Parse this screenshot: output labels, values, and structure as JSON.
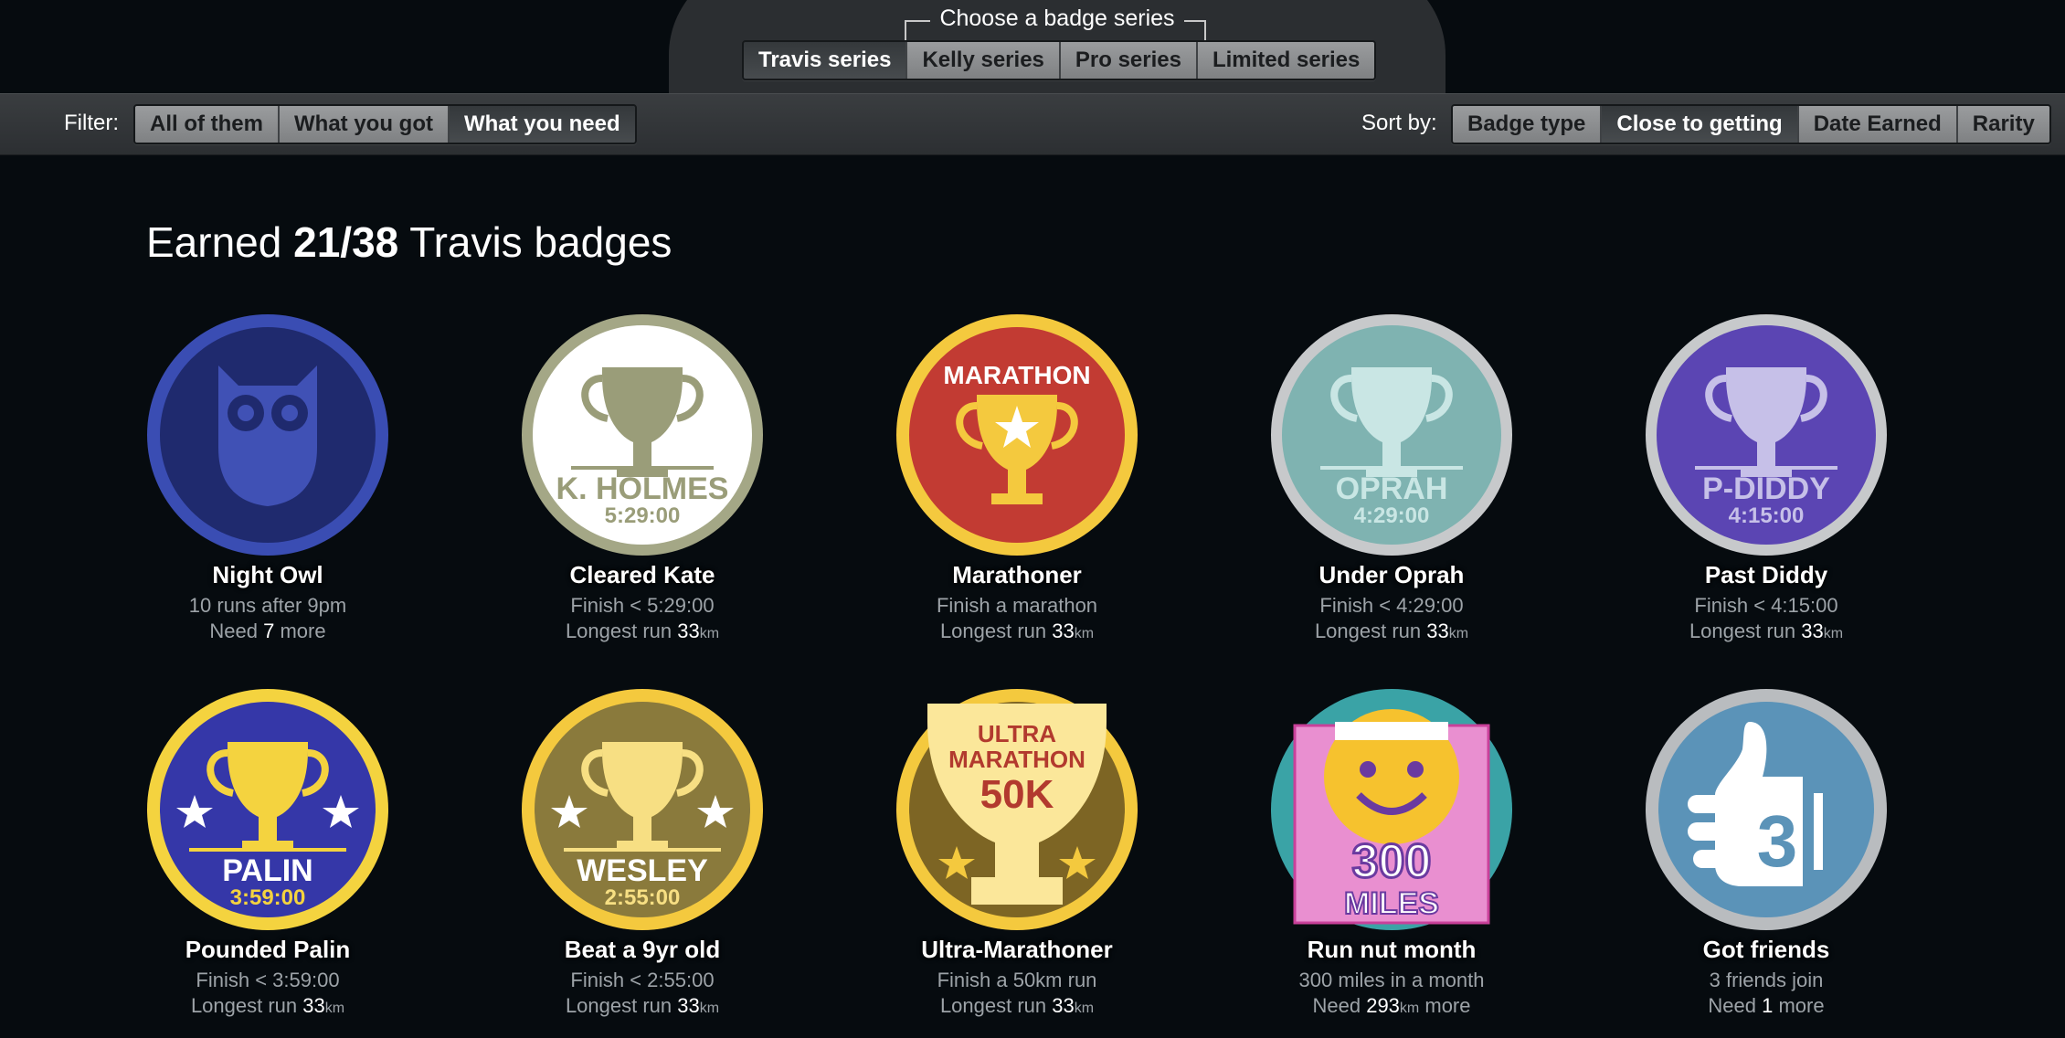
{
  "series": {
    "caption": "Choose a badge series",
    "tabs": [
      "Travis series",
      "Kelly series",
      "Pro series",
      "Limited series"
    ],
    "active": 0
  },
  "filter": {
    "label": "Filter:",
    "options": [
      "All of them",
      "What you got",
      "What you need"
    ],
    "active": 2
  },
  "sort": {
    "label": "Sort by:",
    "options": [
      "Badge type",
      "Close to getting",
      "Date Earned",
      "Rarity"
    ],
    "active": 1
  },
  "heading": {
    "prefix": "Earned ",
    "earned": "21/38",
    "suffix": " Travis badges"
  },
  "badges": [
    {
      "title": "Night Owl",
      "desc": "10 runs after 9pm",
      "need_pre": "Need ",
      "need_val": "7",
      "need_unit": "",
      "need_post": " more",
      "art": "owl",
      "art_text": "",
      "art_time": "",
      "colors": {
        "ring": "#3a4db3",
        "face": "#1f2a6e",
        "fig": "#4051b5"
      }
    },
    {
      "title": "Cleared Kate",
      "desc": "Finish < 5:29:00",
      "need_pre": "Longest run ",
      "need_val": "33",
      "need_unit": "km",
      "need_post": "",
      "art": "trophy-name",
      "art_text": "K. HOLMES",
      "art_time": "5:29:00",
      "colors": {
        "ring": "#a4a786",
        "face": "#ffffff",
        "fig": "#9a9d79"
      }
    },
    {
      "title": "Marathoner",
      "desc": "Finish a marathon",
      "need_pre": "Longest run ",
      "need_val": "33",
      "need_unit": "km",
      "need_post": "",
      "art": "trophy-top",
      "art_text": "MARATHON",
      "art_time": "",
      "colors": {
        "ring": "#f4c93e",
        "face": "#c23b33",
        "fig": "#f4c93e"
      }
    },
    {
      "title": "Under Oprah",
      "desc": "Finish < 4:29:00",
      "need_pre": "Longest run ",
      "need_val": "33",
      "need_unit": "km",
      "need_post": "",
      "art": "trophy-name",
      "art_text": "OPRAH",
      "art_time": "4:29:00",
      "colors": {
        "ring": "#c7c9cb",
        "face": "#7fb3b1",
        "fig": "#c9e6e4"
      }
    },
    {
      "title": "Past Diddy",
      "desc": "Finish < 4:15:00",
      "need_pre": "Longest run ",
      "need_val": "33",
      "need_unit": "km",
      "need_post": "",
      "art": "trophy-name",
      "art_text": "P-DIDDY",
      "art_time": "4:15:00",
      "colors": {
        "ring": "#c7c9cb",
        "face": "#5b45b3",
        "fig": "#c6c0e8"
      }
    },
    {
      "title": "Pounded Palin",
      "desc": "Finish < 3:59:00",
      "need_pre": "Longest run ",
      "need_val": "33",
      "need_unit": "km",
      "need_post": "",
      "art": "trophy-stars",
      "art_text": "PALIN",
      "art_time": "3:59:00",
      "colors": {
        "ring": "#f4d33f",
        "face": "#3537a8",
        "fig": "#f4d33f"
      }
    },
    {
      "title": "Beat a 9yr old",
      "desc": "Finish < 2:55:00",
      "need_pre": "Longest run ",
      "need_val": "33",
      "need_unit": "km",
      "need_post": "",
      "art": "trophy-stars",
      "art_text": "WESLEY",
      "art_time": "2:55:00",
      "colors": {
        "ring": "#f4c93e",
        "face": "#8a7a3c",
        "fig": "#f7df83"
      }
    },
    {
      "title": "Ultra-Marathoner",
      "desc": "Finish a 50km run",
      "need_pre": "Longest run ",
      "need_val": "33",
      "need_unit": "km",
      "need_post": "",
      "art": "ultra",
      "art_text": "ULTRA MARATHON",
      "art_time": "50K",
      "colors": {
        "ring": "#f4c93e",
        "face": "#7d6524",
        "fig": "#fbe79a"
      }
    },
    {
      "title": "Run nut month",
      "desc": "300 miles in a month",
      "need_pre": "Need ",
      "need_val": "293",
      "need_unit": "km",
      "need_post": " more",
      "art": "smiley",
      "art_text": "300",
      "art_time": "MILES",
      "colors": {
        "ring": "#3aa3a6",
        "face": "#e98fd0",
        "fig": "#f6c22e"
      }
    },
    {
      "title": "Got friends",
      "desc": "3 friends join",
      "need_pre": "Need ",
      "need_val": "1",
      "need_unit": "",
      "need_post": " more",
      "art": "thumb",
      "art_text": "3",
      "art_time": "",
      "colors": {
        "ring": "#b9bcbf",
        "face": "#5b93b8",
        "fig": "#ffffff"
      }
    }
  ]
}
